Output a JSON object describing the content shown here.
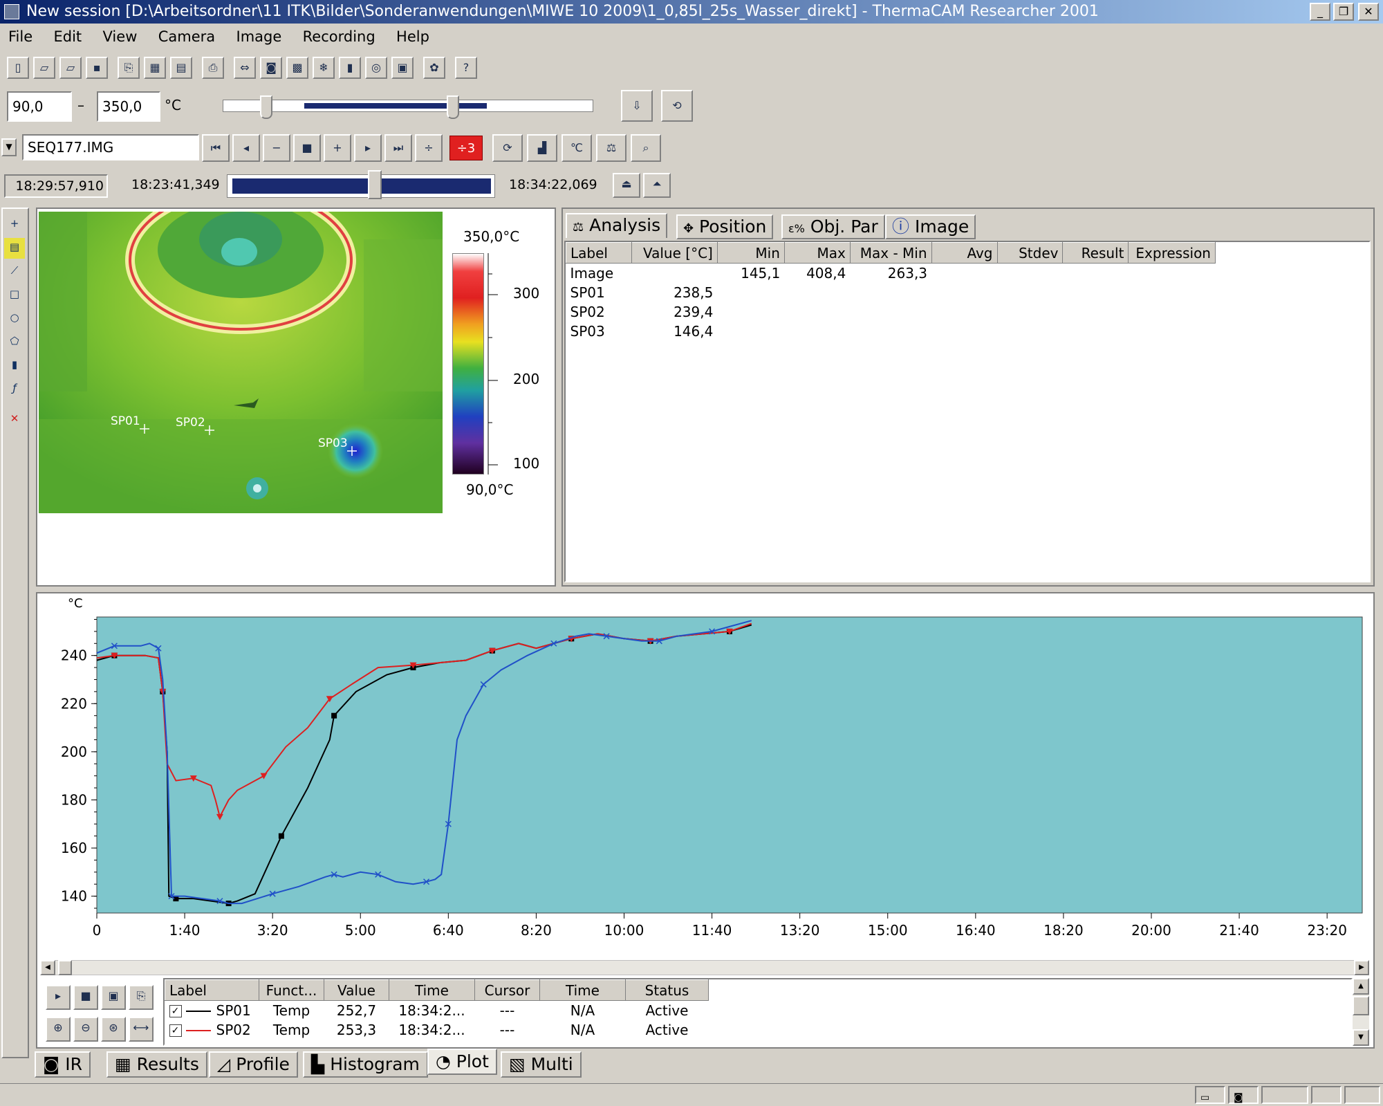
{
  "window": {
    "title": "New session [D:\\Arbeitsordner\\11 ITK\\Bilder\\Sonderanwendungen\\MIWE 10 2009\\1_0,85l_25s_Wasser_direkt] - ThermaCAM Researcher  2001",
    "minimize_glyph": "_",
    "restore_glyph": "❐",
    "close_glyph": "✕"
  },
  "menu": [
    "File",
    "Edit",
    "View",
    "Camera",
    "Image",
    "Recording",
    "Help"
  ],
  "toolbar": {
    "icons": [
      "new-icon",
      "open-icon",
      "open-sequence-icon",
      "save-icon",
      "copy-icon",
      "copy-data-icon",
      "paste-icon",
      "print-icon",
      "image-size-icon",
      "camera-icon",
      "palette-icon",
      "freeze-icon",
      "snapshot-icon",
      "record-icon",
      "settings-icon",
      "color-icon",
      "help-icon"
    ],
    "glyphs": [
      "▯",
      "▱",
      "▱",
      "▪",
      "⎘",
      "▦",
      "▤",
      "⎙",
      "⇔",
      "◙",
      "▩",
      "❄",
      "▮",
      "◎",
      "▣",
      "✿",
      "?"
    ]
  },
  "range": {
    "min_value": "90,0",
    "dash": "–",
    "max_value": "350,0",
    "unit": "°C"
  },
  "sequence": {
    "file_name": "SEQ177.IMG",
    "step_label": "÷3",
    "current_time": "18:29:57,910",
    "start_time": "18:23:41,349",
    "end_time": "18:34:22,069",
    "timeline_position": 0.55
  },
  "ir_image": {
    "scale_max": "350,0°C",
    "scale_min": "90,0°C",
    "scale_ticks": [
      "300",
      "200",
      "100"
    ],
    "spots": [
      "SP01",
      "SP02",
      "SP03"
    ]
  },
  "analysis_tabs": [
    "Analysis",
    "Position",
    "Obj. Par",
    "Image"
  ],
  "analysis_table": {
    "columns": [
      "Label",
      "Value [°C]",
      "Min",
      "Max",
      "Max - Min",
      "Avg",
      "Stdev",
      "Result",
      "Expression"
    ],
    "rows": [
      [
        "Image",
        "",
        "145,1",
        "408,4",
        "263,3",
        "",
        "",
        "",
        ""
      ],
      [
        "SP01",
        "238,5",
        "",
        "",
        "",
        "",
        "",
        "",
        ""
      ],
      [
        "SP02",
        "239,4",
        "",
        "",
        "",
        "",
        "",
        "",
        ""
      ],
      [
        "SP03",
        "146,4",
        "",
        "",
        "",
        "",
        "",
        "",
        ""
      ]
    ]
  },
  "plot": {
    "y_unit": "°C"
  },
  "chart_data": {
    "type": "line",
    "ylabel": "°C",
    "xlim": [
      0,
      1440
    ],
    "ylim": [
      133,
      256
    ],
    "x_ticks": [
      "0",
      "1:40",
      "3:20",
      "5:00",
      "6:40",
      "8:20",
      "10:00",
      "11:40",
      "13:20",
      "15:00",
      "16:40",
      "18:20",
      "20:00",
      "21:40",
      "23:20"
    ],
    "y_ticks": [
      "140",
      "160",
      "180",
      "200",
      "220",
      "240"
    ],
    "y_tick_values": [
      140,
      160,
      180,
      200,
      220,
      240
    ],
    "background": "#7ec6cc",
    "series": [
      {
        "name": "SP01",
        "color": "#000000",
        "x": [
          0,
          20,
          55,
          70,
          75,
          80,
          82,
          90,
          110,
          130,
          150,
          160,
          180,
          210,
          240,
          265,
          270,
          295,
          330,
          360,
          390,
          420,
          450,
          480,
          500,
          540,
          570,
          600,
          630,
          660,
          690,
          720,
          745
        ],
        "y": [
          238,
          240,
          240,
          239,
          225,
          200,
          140,
          139,
          139,
          138,
          137,
          138,
          141,
          165,
          185,
          205,
          215,
          225,
          232,
          235,
          237,
          238,
          242,
          245,
          243,
          247,
          249,
          247,
          246,
          248,
          249,
          250,
          252.7
        ]
      },
      {
        "name": "SP02",
        "color": "#dd2020",
        "x": [
          0,
          20,
          55,
          70,
          75,
          80,
          90,
          110,
          130,
          135,
          140,
          150,
          160,
          190,
          215,
          240,
          265,
          290,
          320,
          360,
          390,
          420,
          450,
          480,
          500,
          540,
          570,
          600,
          630,
          660,
          690,
          720,
          745
        ],
        "y": [
          239,
          240,
          240,
          239,
          225,
          195,
          188,
          189,
          186,
          180,
          173,
          180,
          184,
          190,
          202,
          210,
          222,
          228,
          235,
          236,
          237,
          238,
          242,
          245,
          243,
          247,
          249,
          247,
          246,
          248,
          249,
          250,
          253.3
        ]
      },
      {
        "name": "SP03",
        "color": "#2050c8",
        "x": [
          0,
          20,
          50,
          60,
          70,
          75,
          80,
          85,
          100,
          120,
          140,
          150,
          165,
          200,
          230,
          260,
          270,
          280,
          300,
          320,
          340,
          360,
          375,
          385,
          392,
          400,
          410,
          420,
          440,
          460,
          490,
          520,
          545,
          560,
          580,
          600,
          620,
          640,
          660,
          680,
          700,
          720,
          745
        ],
        "y": [
          241,
          244,
          244,
          245,
          243,
          230,
          200,
          140,
          140,
          139,
          138,
          137,
          137,
          141,
          144,
          148,
          149,
          148,
          150,
          149,
          146,
          145,
          146,
          147,
          149,
          170,
          205,
          215,
          228,
          234,
          240,
          245,
          248,
          249,
          248,
          247,
          246,
          246,
          248,
          249,
          250,
          252,
          254.5
        ]
      }
    ]
  },
  "plot_table": {
    "columns": [
      "Label",
      "Funct...",
      "Value",
      "Time",
      "Cursor",
      "Time",
      "Status"
    ],
    "rows": [
      {
        "label": "SP01",
        "function": "Temp",
        "value": "252,7",
        "time": "18:34:2...",
        "cursor": "---",
        "time2": "N/A",
        "status": "Active",
        "color": "#000000"
      },
      {
        "label": "SP02",
        "function": "Temp",
        "value": "253,3",
        "time": "18:34:2...",
        "cursor": "---",
        "time2": "N/A",
        "status": "Active",
        "color": "#dd2020"
      }
    ]
  },
  "bottom_tabs": [
    "IR",
    "Results",
    "Profile",
    "Histogram",
    "Plot",
    "Multi"
  ],
  "active_bottom_tab": "Plot"
}
